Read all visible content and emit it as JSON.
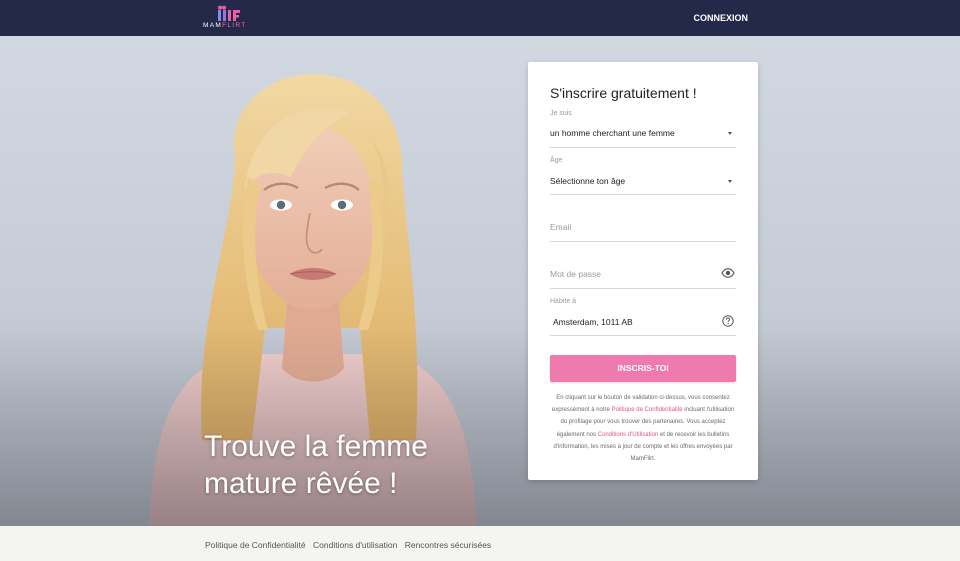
{
  "header": {
    "logo_part1": "MAM",
    "logo_part2": "FLIRT",
    "login_label": "CONNEXION"
  },
  "hero": {
    "title": "Trouve la femme mature rêvée !"
  },
  "form": {
    "title": "S'inscrire gratuitement !",
    "seeking": {
      "label": "Je suis",
      "value": "un homme cherchant une femme"
    },
    "age": {
      "label": "Âge",
      "value": "Sélectionne ton âge"
    },
    "email": {
      "placeholder": "Email"
    },
    "password": {
      "placeholder": "Mot de passe"
    },
    "location": {
      "label": "Habite à",
      "value": "Amsterdam, 1011 AB"
    },
    "submit_label": "INSCRIS-TOI",
    "legal": {
      "part1": "En cliquant sur le bouton de validation ci-dessus, vous consentez expressément à notre ",
      "privacy_link": "Politique de Confidentialité",
      "part2": " incluant l'utilisation du profilage pour vous trouver des partenaires. Vous acceptez également nos ",
      "terms_link": "Conditions d'Utilisation",
      "part3": " et de recevoir les bulletins d'information, les mises à jour de compte et les offres envoyées par MamFlirt."
    }
  },
  "footer": {
    "links": [
      "Politique de Confidentialité",
      "Conditions d'utilisation",
      "Rencontres sécurisées"
    ]
  },
  "colors": {
    "topbar": "#24294a",
    "accent": "#ef7aad",
    "link": "#e0548f"
  },
  "icons": {
    "password_toggle": "eye-icon",
    "location_help": "help-circle-icon",
    "dropdown": "caret-down-icon"
  }
}
